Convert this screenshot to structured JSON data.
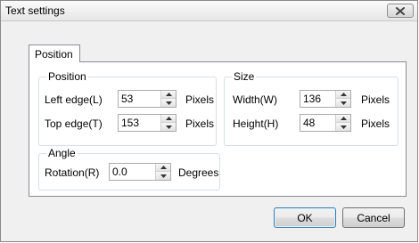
{
  "window": {
    "title": "Text settings"
  },
  "tabs": [
    {
      "label": "Position"
    }
  ],
  "groups": {
    "position": {
      "title": "Position",
      "left_edge": {
        "label": "Left edge(L)",
        "value": "53",
        "unit": "Pixels"
      },
      "top_edge": {
        "label": "Top edge(T)",
        "value": "153",
        "unit": "Pixels"
      }
    },
    "size": {
      "title": "Size",
      "width": {
        "label": "Width(W)",
        "value": "136",
        "unit": "Pixels"
      },
      "height": {
        "label": "Height(H)",
        "value": "48",
        "unit": "Pixels"
      }
    },
    "angle": {
      "title": "Angle",
      "rotation": {
        "label": "Rotation(R)",
        "value": "0.0",
        "unit": "Degrees"
      }
    }
  },
  "buttons": {
    "ok": "OK",
    "cancel": "Cancel"
  },
  "icons": {
    "close": "close-icon",
    "spin_up": "arrow-up-icon",
    "spin_down": "arrow-down-icon"
  }
}
